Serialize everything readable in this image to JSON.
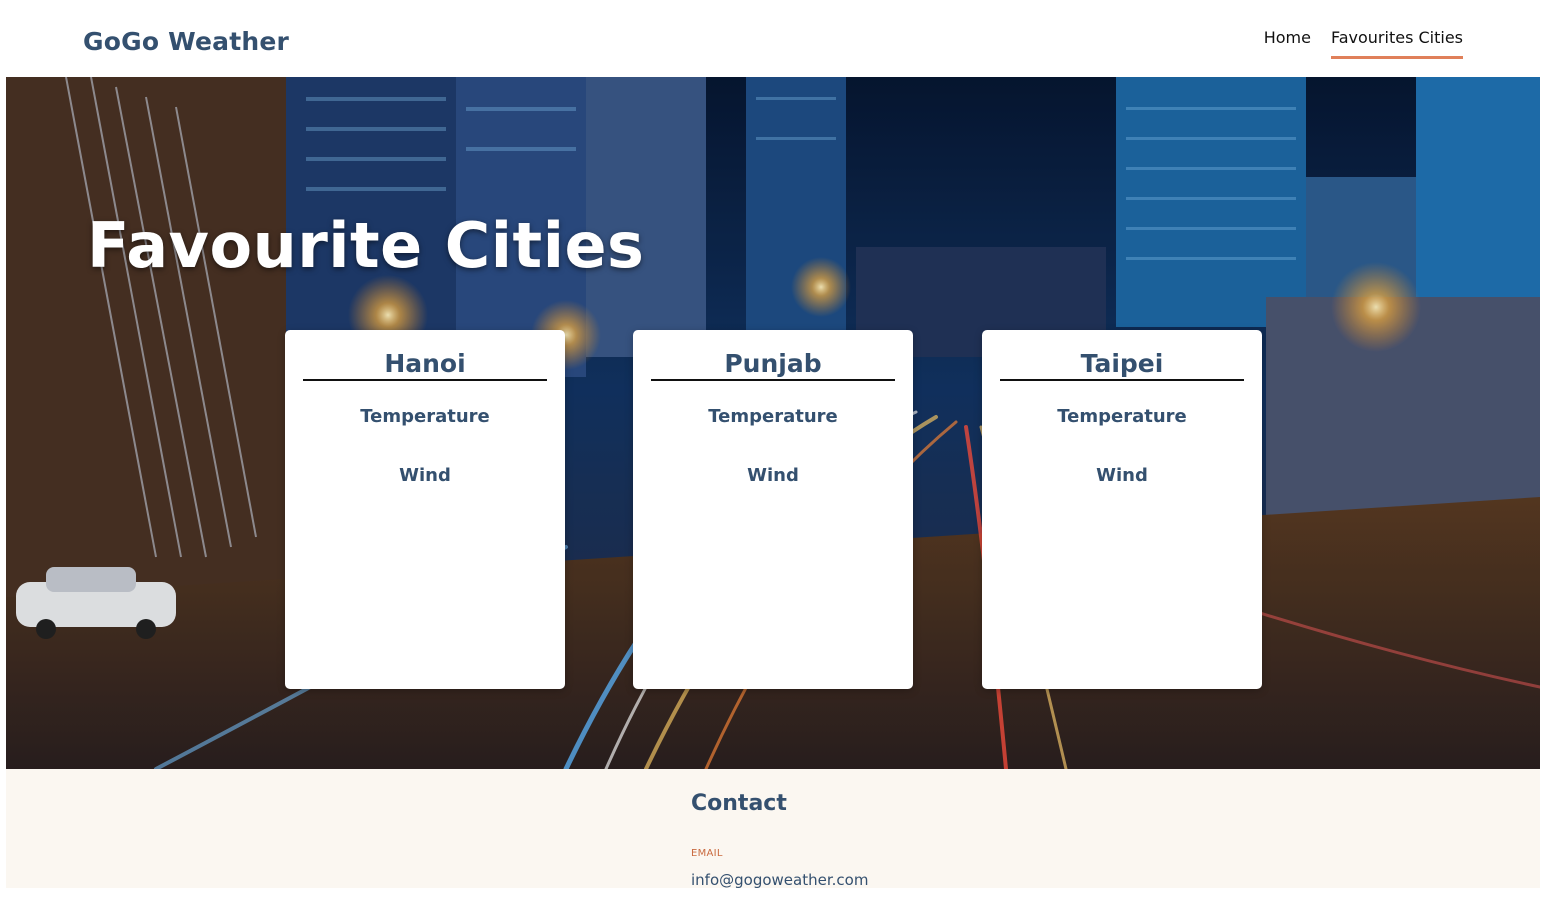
{
  "header": {
    "brand": "GoGo Weather",
    "nav": [
      {
        "label": "Home",
        "active": false
      },
      {
        "label": "Favourites Cities",
        "active": true
      }
    ]
  },
  "hero": {
    "title": "Favourite Cities"
  },
  "cards": [
    {
      "city": "Hanoi",
      "temperature_label": "Temperature",
      "wind_label": "Wind"
    },
    {
      "city": "Punjab",
      "temperature_label": "Temperature",
      "wind_label": "Wind"
    },
    {
      "city": "Taipei",
      "temperature_label": "Temperature",
      "wind_label": "Wind"
    }
  ],
  "footer": {
    "contact_title": "Contact",
    "email_label": "EMAIL",
    "email": "info@gogoweather.com"
  },
  "colors": {
    "brand": "#34506f",
    "accent": "#e0805a",
    "footer_bg": "#fbf7f1"
  }
}
